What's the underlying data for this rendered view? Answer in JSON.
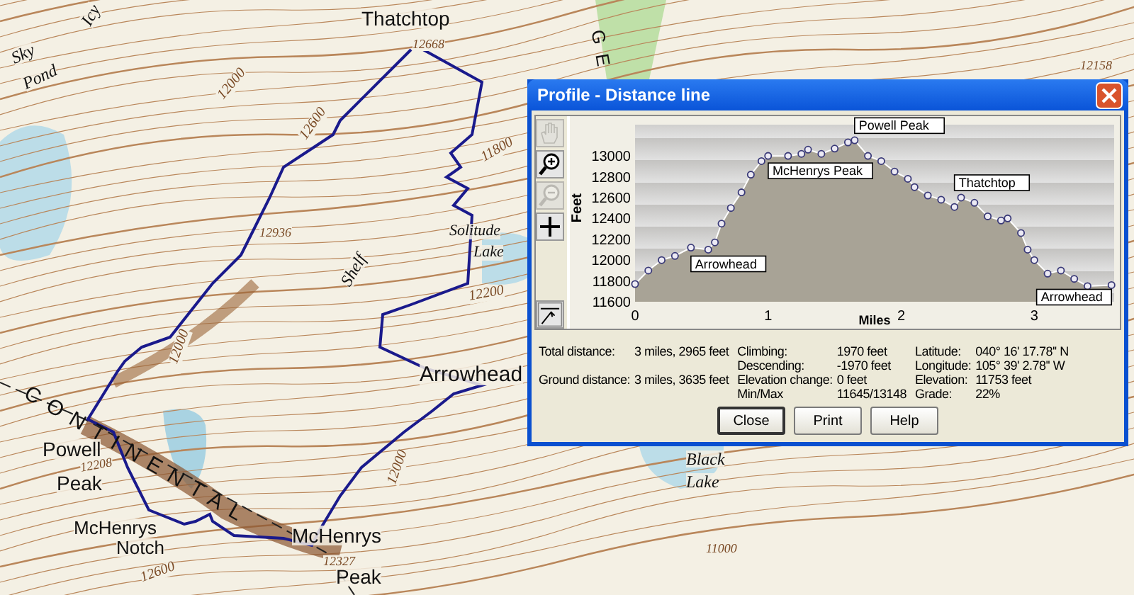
{
  "map": {
    "labels": [
      {
        "text": "Thatchtop",
        "kind": "name"
      },
      {
        "text": "12668",
        "kind": "elevation"
      },
      {
        "text": "Sky",
        "kind": "water"
      },
      {
        "text": "Pond",
        "kind": "water"
      },
      {
        "text": "Icy",
        "kind": "water"
      },
      {
        "text": "12000",
        "kind": "elevation"
      },
      {
        "text": "12600",
        "kind": "elevation"
      },
      {
        "text": "12936",
        "kind": "elevation"
      },
      {
        "text": "11800",
        "kind": "elevation"
      },
      {
        "text": "Solitude",
        "kind": "water"
      },
      {
        "text": "Lake",
        "kind": "water"
      },
      {
        "text": "Shelf",
        "kind": "water"
      },
      {
        "text": "12200",
        "kind": "elevation"
      },
      {
        "text": "Arrowhead",
        "kind": "name"
      },
      {
        "text": "12000",
        "kind": "elevation"
      },
      {
        "text": "CONTINENTAL",
        "kind": "divide"
      },
      {
        "text": "Powell",
        "kind": "name"
      },
      {
        "text": "12208",
        "kind": "elevation"
      },
      {
        "text": "Peak",
        "kind": "name"
      },
      {
        "text": "McHenrys",
        "kind": "name"
      },
      {
        "text": "Notch",
        "kind": "name"
      },
      {
        "text": "McHenrys",
        "kind": "name"
      },
      {
        "text": "12327",
        "kind": "elevation"
      },
      {
        "text": "Peak",
        "kind": "name"
      },
      {
        "text": "12000",
        "kind": "elevation"
      },
      {
        "text": "12600",
        "kind": "elevation"
      },
      {
        "text": "Black",
        "kind": "water"
      },
      {
        "text": "Lake",
        "kind": "water"
      },
      {
        "text": "11000",
        "kind": "elevation"
      },
      {
        "text": "12158",
        "kind": "elevation"
      },
      {
        "text": "GE",
        "kind": "divide"
      }
    ]
  },
  "dialog": {
    "title": "Profile - Distance line",
    "tools": [
      {
        "kind": "hand",
        "disabled": true
      },
      {
        "kind": "zoom-in",
        "disabled": false
      },
      {
        "kind": "zoom-out",
        "disabled": true
      },
      {
        "kind": "crosshair",
        "disabled": false
      }
    ],
    "chart_data": {
      "type": "area",
      "xlabel": "Miles",
      "ylabel": "Feet",
      "x": [
        0,
        0.1,
        0.2,
        0.3,
        0.42,
        0.55,
        0.6,
        0.65,
        0.72,
        0.8,
        0.87,
        0.95,
        1.0,
        1.15,
        1.25,
        1.3,
        1.4,
        1.5,
        1.6,
        1.65,
        1.75,
        1.85,
        1.95,
        2.05,
        2.1,
        2.2,
        2.3,
        2.4,
        2.45,
        2.55,
        2.65,
        2.75,
        2.8,
        2.9,
        2.95,
        3.0,
        3.1,
        3.2,
        3.3,
        3.4,
        3.58
      ],
      "series": [
        {
          "color": "#3a3a78",
          "values": [
            11770,
            11900,
            12000,
            12040,
            12120,
            12100,
            12170,
            12350,
            12500,
            12650,
            12820,
            12950,
            13000,
            13000,
            13020,
            13060,
            13020,
            13070,
            13130,
            13150,
            13000,
            12950,
            12850,
            12780,
            12700,
            12620,
            12580,
            12510,
            12600,
            12550,
            12420,
            12380,
            12400,
            12260,
            12100,
            12000,
            11870,
            11900,
            11820,
            11750,
            11760
          ]
        }
      ],
      "xlim": [
        0,
        3.6
      ],
      "ylim": [
        11600,
        13300
      ],
      "xticks": [
        0,
        1,
        2,
        3
      ],
      "yticks": [
        11600,
        11800,
        12000,
        12200,
        12400,
        12600,
        12800,
        13000
      ],
      "annotations": [
        {
          "x": 0.42,
          "y": 12120,
          "text": "Arrowhead"
        },
        {
          "x": 1.15,
          "y": 13000,
          "text": "McHenrys Peak"
        },
        {
          "x": 1.65,
          "y": 13148,
          "text": "Powell Peak"
        },
        {
          "x": 2.4,
          "y": 12600,
          "text": "Thatchtop"
        },
        {
          "x": 3.58,
          "y": 11760,
          "text": "Arrowhead"
        }
      ]
    },
    "stats": [
      [
        {
          "label": "Total distance:",
          "value": "3 miles, 2965 feet"
        },
        {
          "label": "Ground distance:",
          "value": "3 miles, 3635 feet"
        }
      ],
      [
        {
          "label": "Climbing:",
          "value": "1970 feet"
        },
        {
          "label": "Descending:",
          "value": "-1970 feet"
        },
        {
          "label": "Elevation change:",
          "value": "0 feet"
        },
        {
          "label": "Min/Max",
          "value": "11645/13148"
        }
      ],
      [
        {
          "label": "Latitude:",
          "value": "040° 16' 17.78'' N"
        },
        {
          "label": "Longitude:",
          "value": "105° 39' 2.78'' W"
        },
        {
          "label": "Elevation:",
          "value": "11753 feet"
        },
        {
          "label": "Grade:",
          "value": "22%"
        }
      ]
    ],
    "buttons": [
      {
        "label": "Close",
        "selected": true
      },
      {
        "label": "Print",
        "selected": false
      },
      {
        "label": "Help",
        "selected": false
      }
    ]
  }
}
